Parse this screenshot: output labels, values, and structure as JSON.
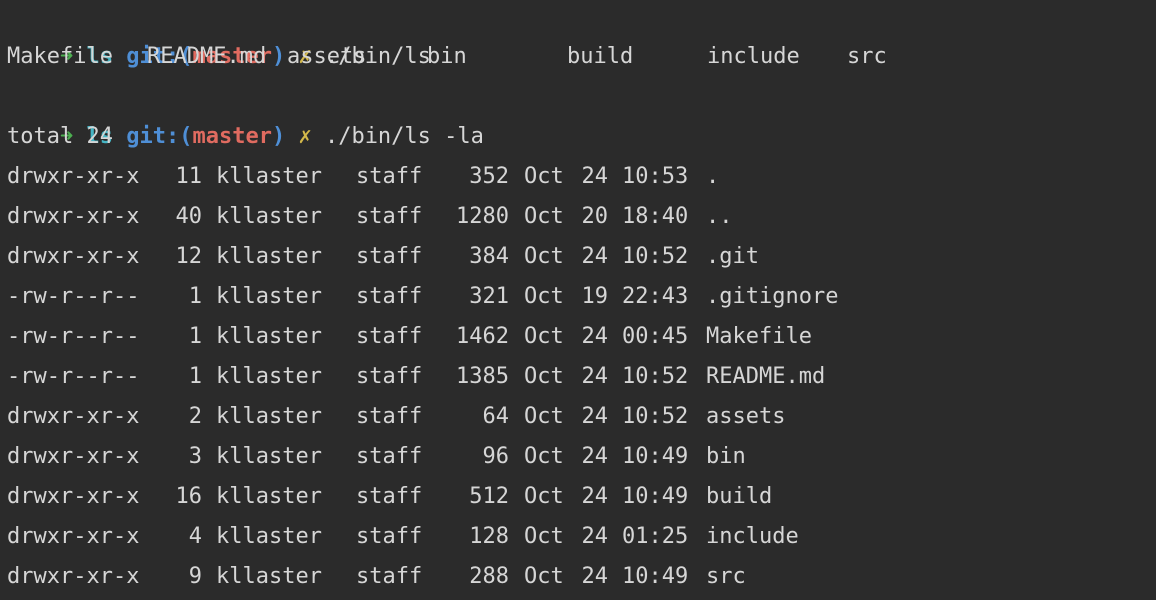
{
  "terminal": {
    "prompts": [
      {
        "arrow": "➜",
        "dir": "ls",
        "git_label": "git:",
        "paren_open": "(",
        "branch": "master",
        "paren_close": ")",
        "dirty": "✗",
        "command": "./bin/ls"
      },
      {
        "arrow": "➜",
        "dir": "ls",
        "git_label": "git:",
        "paren_open": "(",
        "branch": "master",
        "paren_close": ")",
        "dirty": "✗",
        "command": "./bin/ls -la"
      }
    ],
    "ls_output": [
      "Makefile",
      "README.md",
      "assets",
      "bin",
      "build",
      "include",
      "src"
    ],
    "total": "total 24",
    "listing": [
      {
        "perm": "drwxr-xr-x",
        "links": "11",
        "owner": "kllaster",
        "group": "staff",
        "size": "352",
        "month": "Oct",
        "day": "24",
        "time": "10:53",
        "name": "."
      },
      {
        "perm": "drwxr-xr-x",
        "links": "40",
        "owner": "kllaster",
        "group": "staff",
        "size": "1280",
        "month": "Oct",
        "day": "20",
        "time": "18:40",
        "name": ".."
      },
      {
        "perm": "drwxr-xr-x",
        "links": "12",
        "owner": "kllaster",
        "group": "staff",
        "size": "384",
        "month": "Oct",
        "day": "24",
        "time": "10:52",
        "name": ".git"
      },
      {
        "perm": "-rw-r--r--",
        "links": "1",
        "owner": "kllaster",
        "group": "staff",
        "size": "321",
        "month": "Oct",
        "day": "19",
        "time": "22:43",
        "name": ".gitignore"
      },
      {
        "perm": "-rw-r--r--",
        "links": "1",
        "owner": "kllaster",
        "group": "staff",
        "size": "1462",
        "month": "Oct",
        "day": "24",
        "time": "00:45",
        "name": "Makefile"
      },
      {
        "perm": "-rw-r--r--",
        "links": "1",
        "owner": "kllaster",
        "group": "staff",
        "size": "1385",
        "month": "Oct",
        "day": "24",
        "time": "10:52",
        "name": "README.md"
      },
      {
        "perm": "drwxr-xr-x",
        "links": "2",
        "owner": "kllaster",
        "group": "staff",
        "size": "64",
        "month": "Oct",
        "day": "24",
        "time": "10:52",
        "name": "assets"
      },
      {
        "perm": "drwxr-xr-x",
        "links": "3",
        "owner": "kllaster",
        "group": "staff",
        "size": "96",
        "month": "Oct",
        "day": "24",
        "time": "10:49",
        "name": "bin"
      },
      {
        "perm": "drwxr-xr-x",
        "links": "16",
        "owner": "kllaster",
        "group": "staff",
        "size": "512",
        "month": "Oct",
        "day": "24",
        "time": "10:49",
        "name": "build"
      },
      {
        "perm": "drwxr-xr-x",
        "links": "4",
        "owner": "kllaster",
        "group": "staff",
        "size": "128",
        "month": "Oct",
        "day": "24",
        "time": "01:25",
        "name": "include"
      },
      {
        "perm": "drwxr-xr-x",
        "links": "9",
        "owner": "kllaster",
        "group": "staff",
        "size": "288",
        "month": "Oct",
        "day": "24",
        "time": "10:49",
        "name": "src"
      }
    ]
  }
}
